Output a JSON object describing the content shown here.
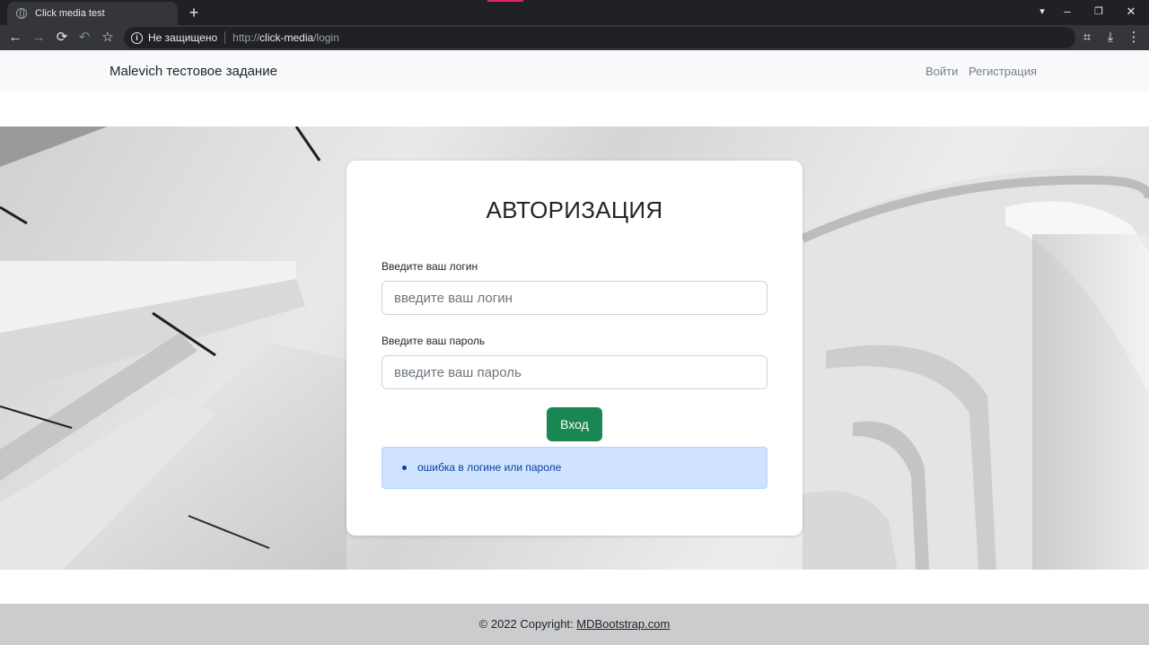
{
  "browser": {
    "tab_title": "Click media test",
    "new_tab": "+",
    "security_text": "Не защищено",
    "url_scheme": "http://",
    "url_host": "click-media",
    "url_path": "/login",
    "window_controls": {
      "minimize": "–",
      "restore": "❐",
      "close": "✕",
      "tabs_menu": "▾"
    },
    "toolbar_icons": {
      "back": "←",
      "forward": "→",
      "reload": "⟳",
      "undo": "↶",
      "bookmark": "☆",
      "bookmark_right": "☆",
      "crop": "⌗",
      "download": "⤓",
      "menu": "⋮"
    },
    "info_icon": "i"
  },
  "navbar": {
    "brand": "Malevich тестовое задание",
    "links": [
      "Войти",
      "Регистрация"
    ]
  },
  "login_card": {
    "title": "АВТОРИЗАЦИЯ",
    "login_label": "Введите ваш логин",
    "login_placeholder": "введите ваш логин",
    "login_value": "",
    "password_label": "Введите ваш пароль",
    "password_placeholder": "введите ваш пароль",
    "password_value": "",
    "submit_label": "Вход",
    "errors": [
      "ошибка в логине или пароле"
    ]
  },
  "footer": {
    "copyright": "© 2022 Copyright: ",
    "link_text": "MDBootstrap.com"
  },
  "colors": {
    "submit_bg": "#198754",
    "alert_bg": "#cfe2ff",
    "alert_text": "#084298",
    "navbar_bg": "#f8f9fa",
    "footer_bg": "#cbcccd",
    "chrome_dark": "#202124"
  }
}
